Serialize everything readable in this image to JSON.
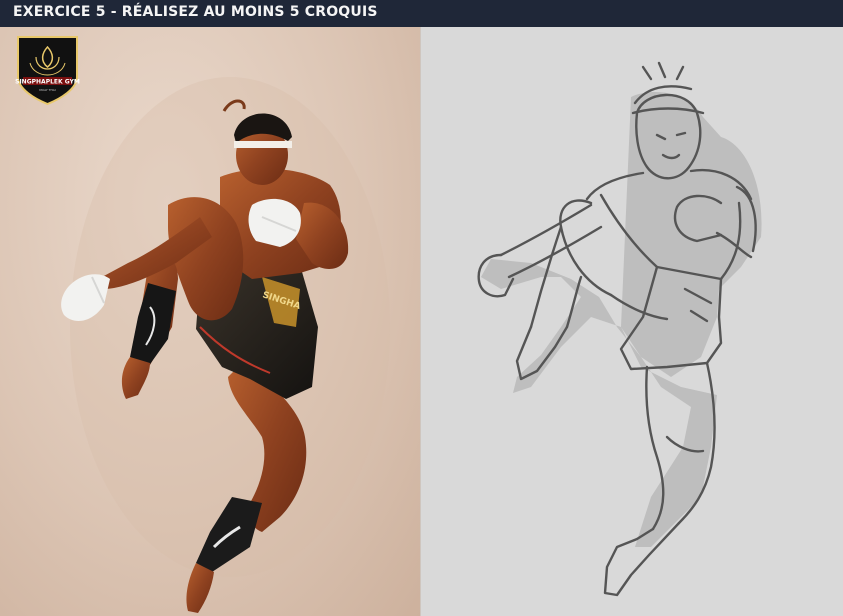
{
  "title": "EXERCICE 5 - RÉALISEZ AU MOINS 5 CROQUIS",
  "photo": {
    "logo": {
      "name": "SINGPHAPLEK GYM",
      "caption": "MUAY THAI"
    },
    "subject": "fighter-jumping-knee",
    "short_brand": "SINGHA"
  },
  "sketch": {
    "subject": "fighter-sketch"
  },
  "colors": {
    "titlebar_bg": "#1f2738",
    "title_text": "#f5f5f5",
    "photo_bg": "#dcc5b4",
    "sketch_bg": "#d9d9d9",
    "skin": "#9a4a24",
    "shorts": "#2b2620",
    "wrap": "#f2f2f0"
  }
}
